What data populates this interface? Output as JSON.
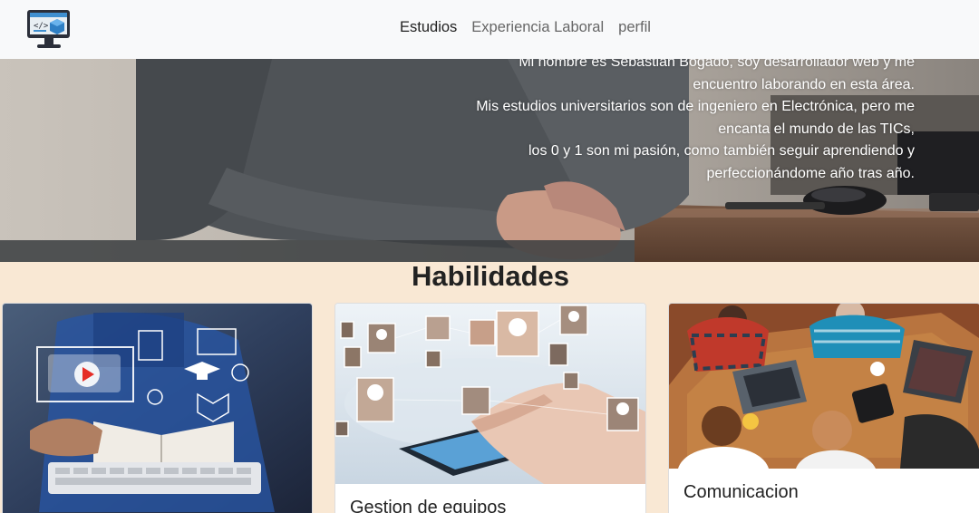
{
  "navbar": {
    "logo_icon": "computer-code-icon",
    "links": [
      {
        "label": "Estudios",
        "active": true
      },
      {
        "label": "Experiencia Laboral",
        "active": false
      },
      {
        "label": "perfil",
        "active": false
      }
    ]
  },
  "hero": {
    "text_lines": [
      "Mi nombre es Sebastián Bogado, soy desarrollador web y me",
      "encuentro laborando en esta área.",
      "Mis estudios universitarios son de ingeniero en Electrónica, pero me",
      "encanta el mundo de las TICs,",
      "los 0 y 1 son mi pasión, como también seguir aprendiendo y",
      "perfeccionándome año tras año."
    ]
  },
  "skills": {
    "title": "Habilidades",
    "cards": [
      {
        "title": "",
        "image": "online-education-image"
      },
      {
        "title": "Gestion de equipos",
        "image": "team-network-image"
      },
      {
        "title": "Comunicacion",
        "image": "teamwork-meeting-image"
      }
    ]
  },
  "colors": {
    "navbar_bg": "#f8f9fa",
    "page_bg": "#f9e8d4",
    "accent_red": "#e52d27"
  }
}
